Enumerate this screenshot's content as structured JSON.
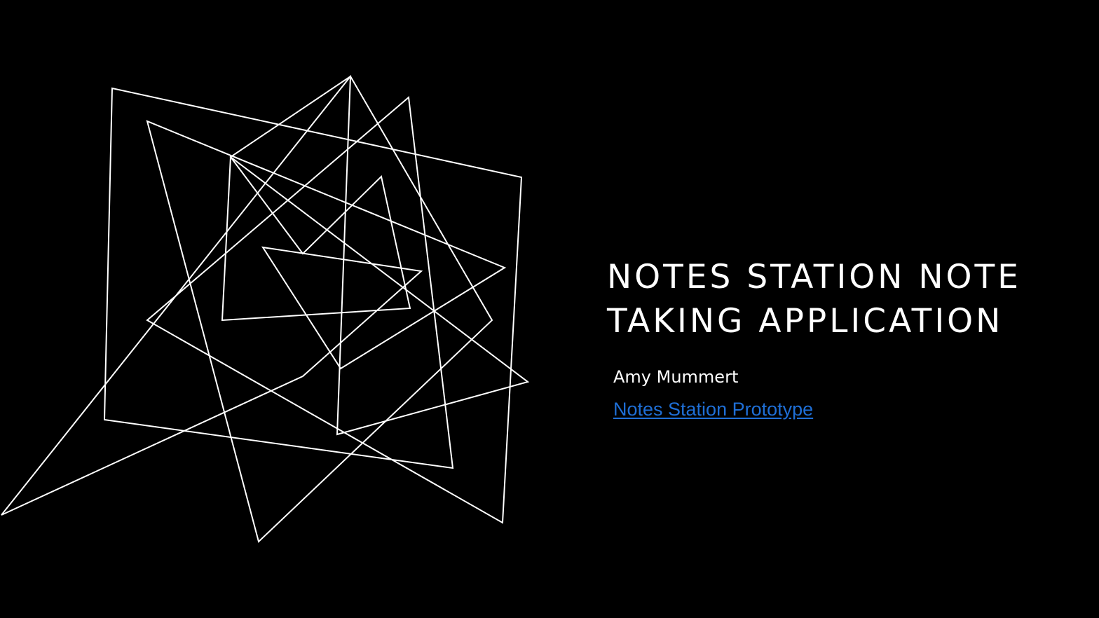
{
  "slide": {
    "title_lines": [
      "NOTES STATION NOTE",
      "TAKING APPLICATION"
    ],
    "author": "Amy Mummert",
    "link_text": "Notes Station Prototype"
  },
  "colors": {
    "background": "#000000",
    "foreground": "#ffffff",
    "link": "#1f6fd6"
  },
  "decoration": {
    "artwork": "abstract-white-line-polygons"
  }
}
